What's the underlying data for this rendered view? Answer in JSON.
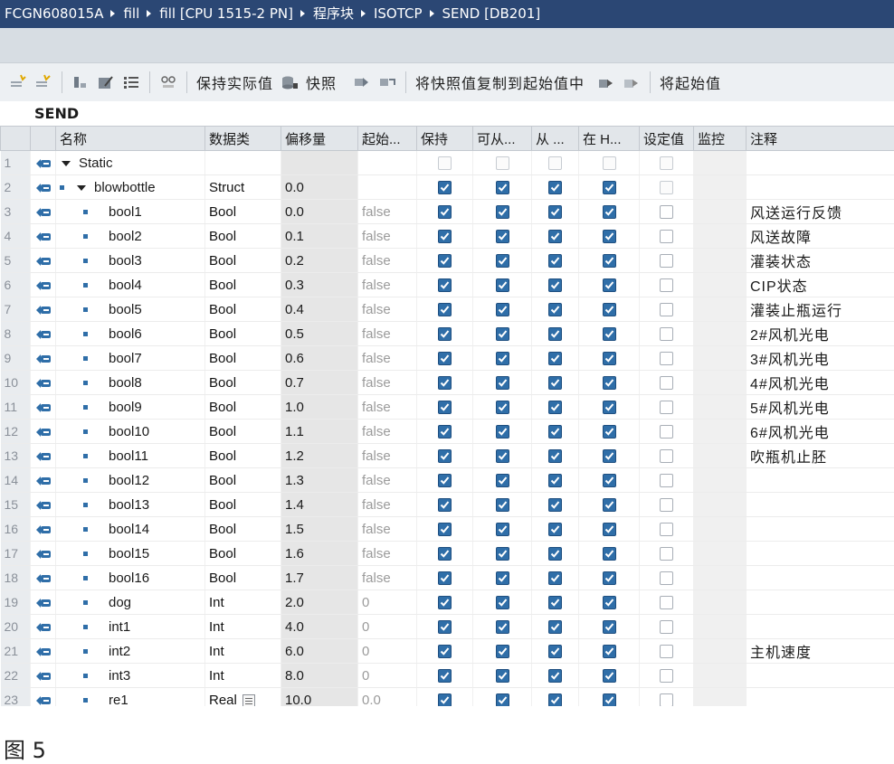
{
  "breadcrumb": [
    "FCGN608015A",
    "fill",
    "fill [CPU 1515-2 PN]",
    "程序块",
    "ISOTCP",
    "SEND [DB201]"
  ],
  "toolbar": {
    "keep_actual_label": "保持实际值",
    "snapshot_label": "快照",
    "copy_snapshot_label": "将快照值复制到起始值中",
    "load_start_label": "将起始值"
  },
  "db_title": "SEND",
  "columns": {
    "name": "名称",
    "datatype": "数据类",
    "offset": "偏移量",
    "start": "起始...",
    "retain": "保持",
    "accessible": "可从...",
    "writable": "从 ...",
    "visible": "在 H...",
    "setpoint": "设定值",
    "monitor": "监控",
    "comment": "注释"
  },
  "rows": [
    {
      "num": "1",
      "name": "Static",
      "type": "",
      "offset": "",
      "start": "",
      "comment": "",
      "level": 0,
      "expander": true,
      "checks": "dim"
    },
    {
      "num": "2",
      "name": "blowbottle",
      "type": "Struct",
      "offset": "0.0",
      "start": "",
      "comment": "",
      "level": 1,
      "expander": true,
      "checks": "on"
    },
    {
      "num": "3",
      "name": "bool1",
      "type": "Bool",
      "offset": "0.0",
      "start": "false",
      "comment": "风送运行反馈",
      "level": 2
    },
    {
      "num": "4",
      "name": "bool2",
      "type": "Bool",
      "offset": "0.1",
      "start": "false",
      "comment": "风送故障",
      "level": 2
    },
    {
      "num": "5",
      "name": "bool3",
      "type": "Bool",
      "offset": "0.2",
      "start": "false",
      "comment": "灌装状态",
      "level": 2
    },
    {
      "num": "6",
      "name": "bool4",
      "type": "Bool",
      "offset": "0.3",
      "start": "false",
      "comment": "CIP状态",
      "level": 2
    },
    {
      "num": "7",
      "name": "bool5",
      "type": "Bool",
      "offset": "0.4",
      "start": "false",
      "comment": "灌装止瓶运行",
      "level": 2
    },
    {
      "num": "8",
      "name": "bool6",
      "type": "Bool",
      "offset": "0.5",
      "start": "false",
      "comment": "2#风机光电",
      "level": 2
    },
    {
      "num": "9",
      "name": "bool7",
      "type": "Bool",
      "offset": "0.6",
      "start": "false",
      "comment": "3#风机光电",
      "level": 2
    },
    {
      "num": "10",
      "name": "bool8",
      "type": "Bool",
      "offset": "0.7",
      "start": "false",
      "comment": "4#风机光电",
      "level": 2
    },
    {
      "num": "11",
      "name": "bool9",
      "type": "Bool",
      "offset": "1.0",
      "start": "false",
      "comment": "5#风机光电",
      "level": 2
    },
    {
      "num": "12",
      "name": "bool10",
      "type": "Bool",
      "offset": "1.1",
      "start": "false",
      "comment": "6#风机光电",
      "level": 2
    },
    {
      "num": "13",
      "name": "bool11",
      "type": "Bool",
      "offset": "1.2",
      "start": "false",
      "comment": "吹瓶机止胚",
      "level": 2
    },
    {
      "num": "14",
      "name": "bool12",
      "type": "Bool",
      "offset": "1.3",
      "start": "false",
      "comment": "",
      "level": 2
    },
    {
      "num": "15",
      "name": "bool13",
      "type": "Bool",
      "offset": "1.4",
      "start": "false",
      "comment": "",
      "level": 2
    },
    {
      "num": "16",
      "name": "bool14",
      "type": "Bool",
      "offset": "1.5",
      "start": "false",
      "comment": "",
      "level": 2
    },
    {
      "num": "17",
      "name": "bool15",
      "type": "Bool",
      "offset": "1.6",
      "start": "false",
      "comment": "",
      "level": 2
    },
    {
      "num": "18",
      "name": "bool16",
      "type": "Bool",
      "offset": "1.7",
      "start": "false",
      "comment": "",
      "level": 2
    },
    {
      "num": "19",
      "name": "dog",
      "type": "Int",
      "offset": "2.0",
      "start": "0",
      "comment": "",
      "level": 2
    },
    {
      "num": "20",
      "name": "int1",
      "type": "Int",
      "offset": "4.0",
      "start": "0",
      "comment": "",
      "level": 2
    },
    {
      "num": "21",
      "name": "int2",
      "type": "Int",
      "offset": "6.0",
      "start": "0",
      "comment": "主机速度",
      "level": 2
    },
    {
      "num": "22",
      "name": "int3",
      "type": "Int",
      "offset": "8.0",
      "start": "0",
      "comment": "",
      "level": 2
    },
    {
      "num": "23",
      "name": "re1",
      "type": "Real",
      "offset": "10.0",
      "start": "0.0",
      "comment": "",
      "level": 2,
      "picker": true
    }
  ],
  "caption": "图 5",
  "colors": {
    "title_bar": "#2b4774",
    "check_on": "#2f6ea8",
    "io_icon": "#2f6ea8"
  }
}
